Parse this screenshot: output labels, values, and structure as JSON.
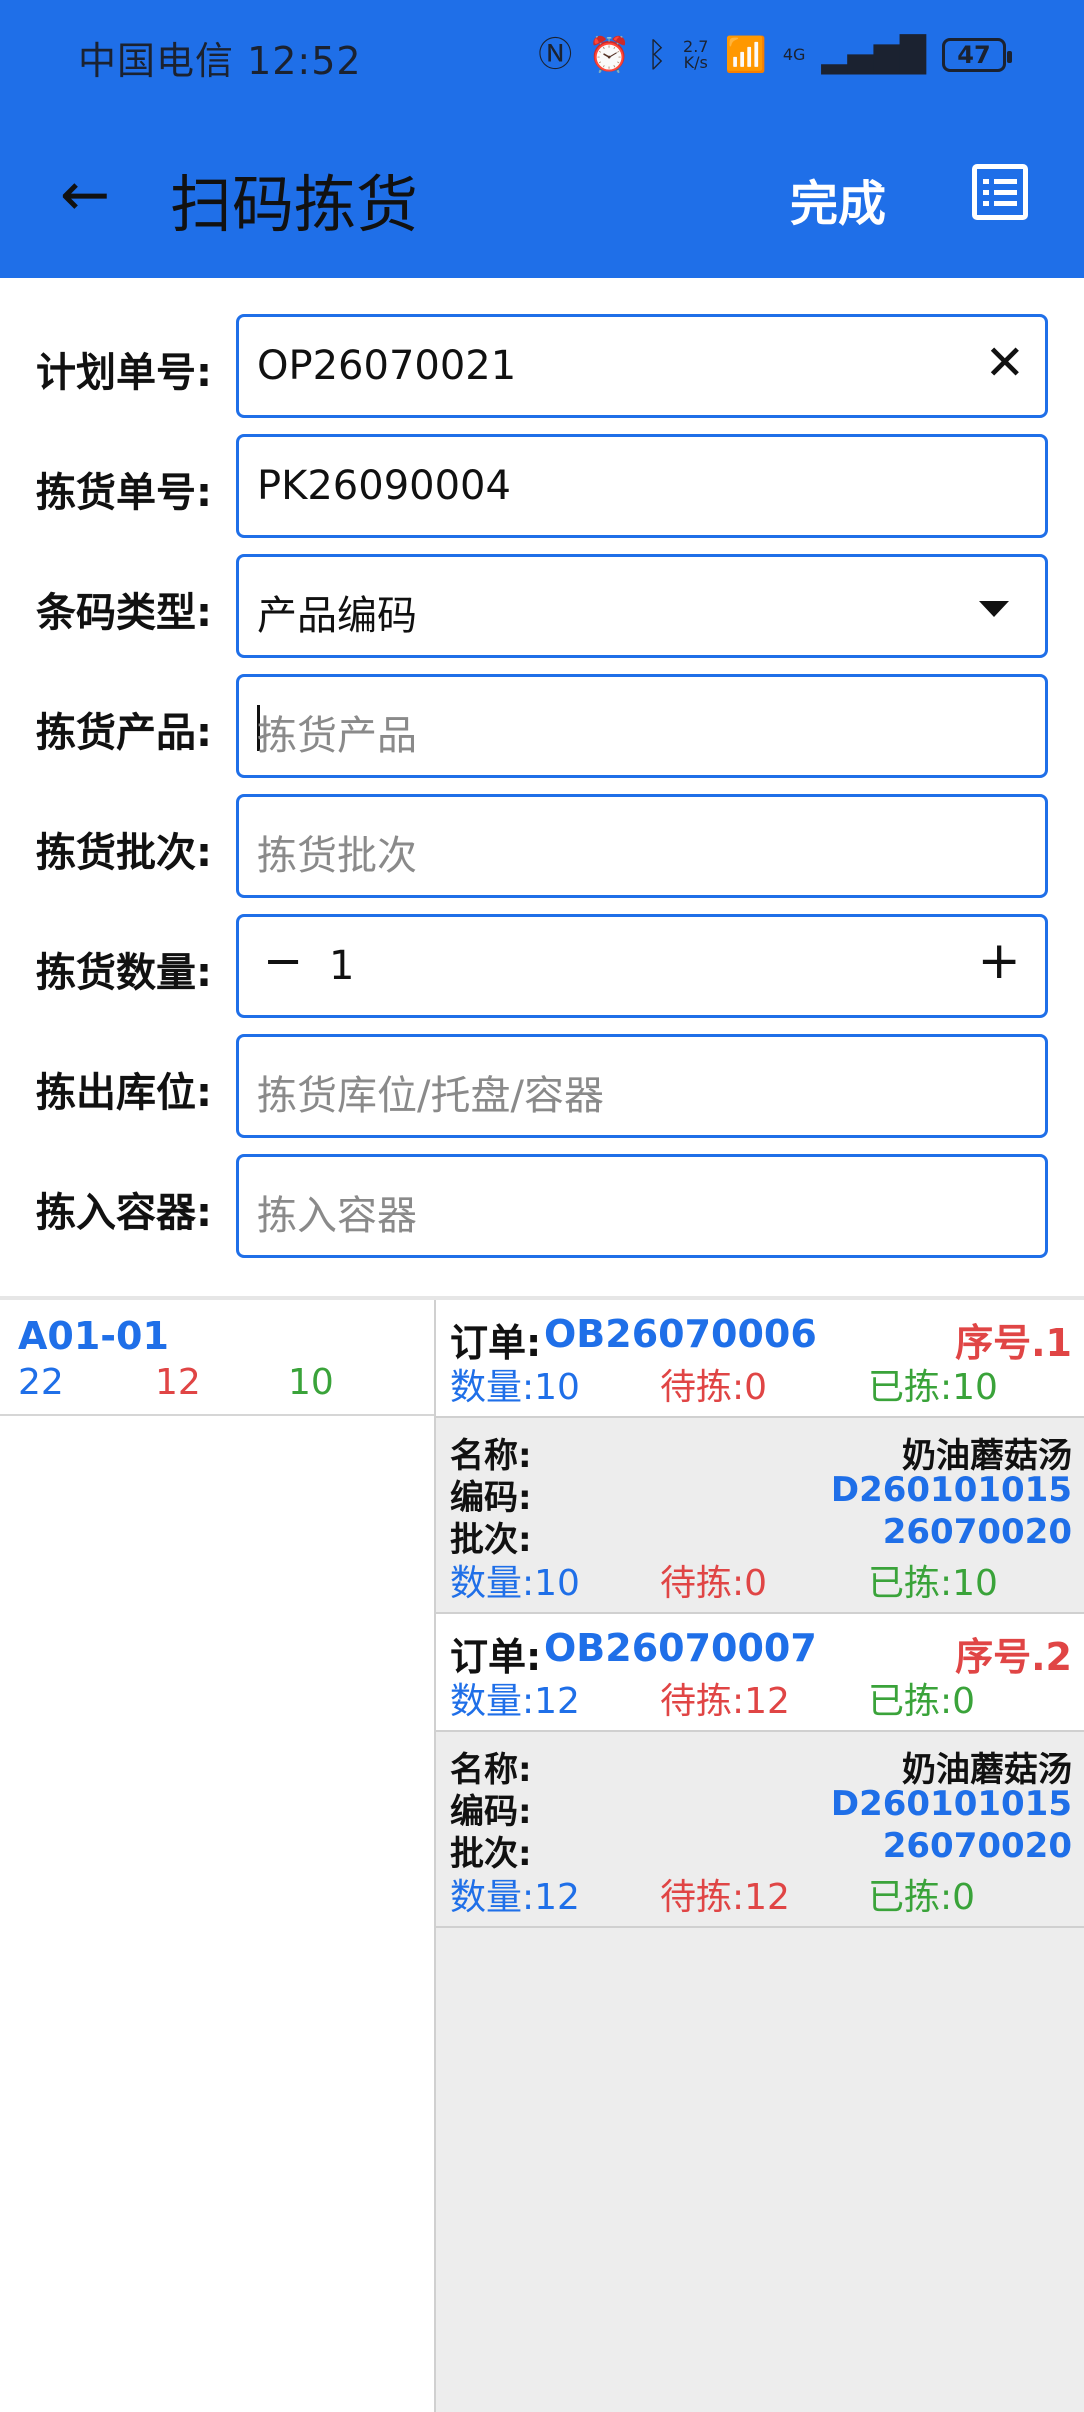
{
  "status_bar": {
    "carrier_time": "中国电信 12:52",
    "net_speed_top": "2.7",
    "net_speed_bottom": "K/s",
    "signal_label": "4G",
    "battery": "47"
  },
  "appbar": {
    "title": "扫码拣货",
    "done_label": "完成"
  },
  "form": {
    "plan_no": {
      "label": "计划单号:",
      "value": "OP26070021"
    },
    "pick_no": {
      "label": "拣货单号:",
      "value": "PK26090004"
    },
    "barcode_type": {
      "label": "条码类型:",
      "value": "产品编码"
    },
    "pick_product": {
      "label": "拣货产品:",
      "placeholder": "拣货产品"
    },
    "pick_batch": {
      "label": "拣货批次:",
      "placeholder": "拣货批次"
    },
    "pick_qty": {
      "label": "拣货数量:",
      "value": "1"
    },
    "out_location": {
      "label": "拣出库位:",
      "placeholder": "拣货库位/托盘/容器"
    },
    "in_container": {
      "label": "拣入容器:",
      "placeholder": "拣入容器"
    }
  },
  "locations": [
    {
      "code": "A01-01",
      "total": "22",
      "pending": "12",
      "picked": "10"
    }
  ],
  "orders": [
    {
      "order_label": "订单:",
      "order_no": "OB26070006",
      "seq": "序号.1",
      "qty": "数量:10",
      "pending": "待拣:0",
      "picked": "已拣:10",
      "detail": {
        "name_label": "名称:",
        "name": "奶油蘑菇汤",
        "code_label": "编码:",
        "code": "D260101015",
        "batch_label": "批次:",
        "batch": "26070020",
        "qty": "数量:10",
        "pending": "待拣:0",
        "picked": "已拣:10"
      }
    },
    {
      "order_label": "订单:",
      "order_no": "OB26070007",
      "seq": "序号.2",
      "qty": "数量:12",
      "pending": "待拣:12",
      "picked": "已拣:0",
      "detail": {
        "name_label": "名称:",
        "name": "奶油蘑菇汤",
        "code_label": "编码:",
        "code": "D260101015",
        "batch_label": "批次:",
        "batch": "26070020",
        "qty": "数量:12",
        "pending": "待拣:12",
        "picked": "已拣:0"
      }
    }
  ],
  "colors": {
    "primary": "#1f6fe8",
    "red": "#e04545",
    "green": "#3aa33a"
  }
}
